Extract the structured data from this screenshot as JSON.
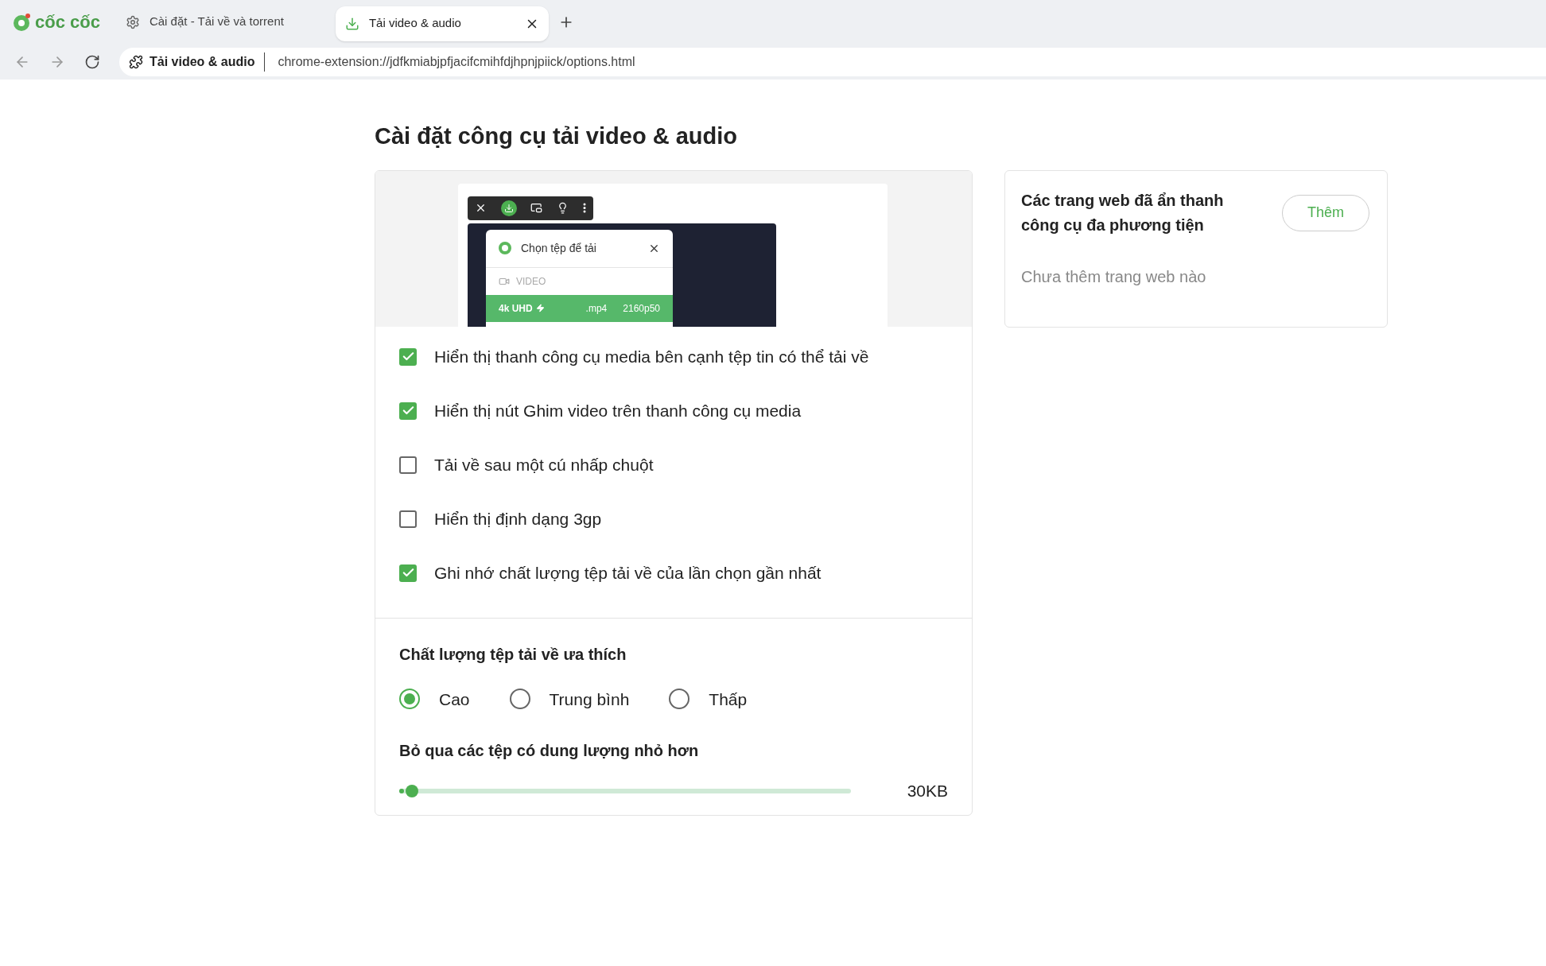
{
  "browser": {
    "logo_text": "cốc cốc",
    "tabs": [
      {
        "label": "Cài đặt - Tải về và torrent",
        "selected": false,
        "kind": "settings"
      },
      {
        "label": "Tải video & audio",
        "selected": true,
        "kind": "download"
      }
    ],
    "address_bar": {
      "page_label": "Tải video & audio",
      "url": "chrome-extension://jdfkmiabjpfjacifcmihfdjhpnjpiick/options.html"
    }
  },
  "page": {
    "title": "Cài đặt công cụ tải video & audio",
    "illustration": {
      "popup_title": "Chọn tệp để tải",
      "section": "VIDEO",
      "option": {
        "quality": "4k UHD",
        "format": ".mp4",
        "resolution": "2160p50"
      }
    },
    "options": [
      {
        "label": "Hiển thị thanh công cụ media bên cạnh tệp tin có thể tải về",
        "checked": true
      },
      {
        "label": "Hiển thị nút Ghim video trên thanh công cụ media",
        "checked": true
      },
      {
        "label": "Tải về sau một cú nhấp chuột",
        "checked": false
      },
      {
        "label": "Hiển thị định dạng 3gp",
        "checked": false
      },
      {
        "label": "Ghi nhớ chất lượng tệp tải về của lần chọn gần nhất",
        "checked": true
      }
    ],
    "quality": {
      "heading": "Chất lượng tệp tải về ưa thích",
      "choices": [
        {
          "label": "Cao",
          "selected": true
        },
        {
          "label": "Trung bình",
          "selected": false
        },
        {
          "label": "Thấp",
          "selected": false
        }
      ]
    },
    "min_size": {
      "heading": "Bỏ qua các tệp có dung lượng nhỏ hơn",
      "level": 0.01,
      "reading": "30KB"
    },
    "hidden_sites": {
      "title": "Các trang web đã ẩn thanh công cụ đa phương tiện",
      "add_button": "Thêm",
      "empty_text": "Chưa thêm trang web nào"
    }
  }
}
